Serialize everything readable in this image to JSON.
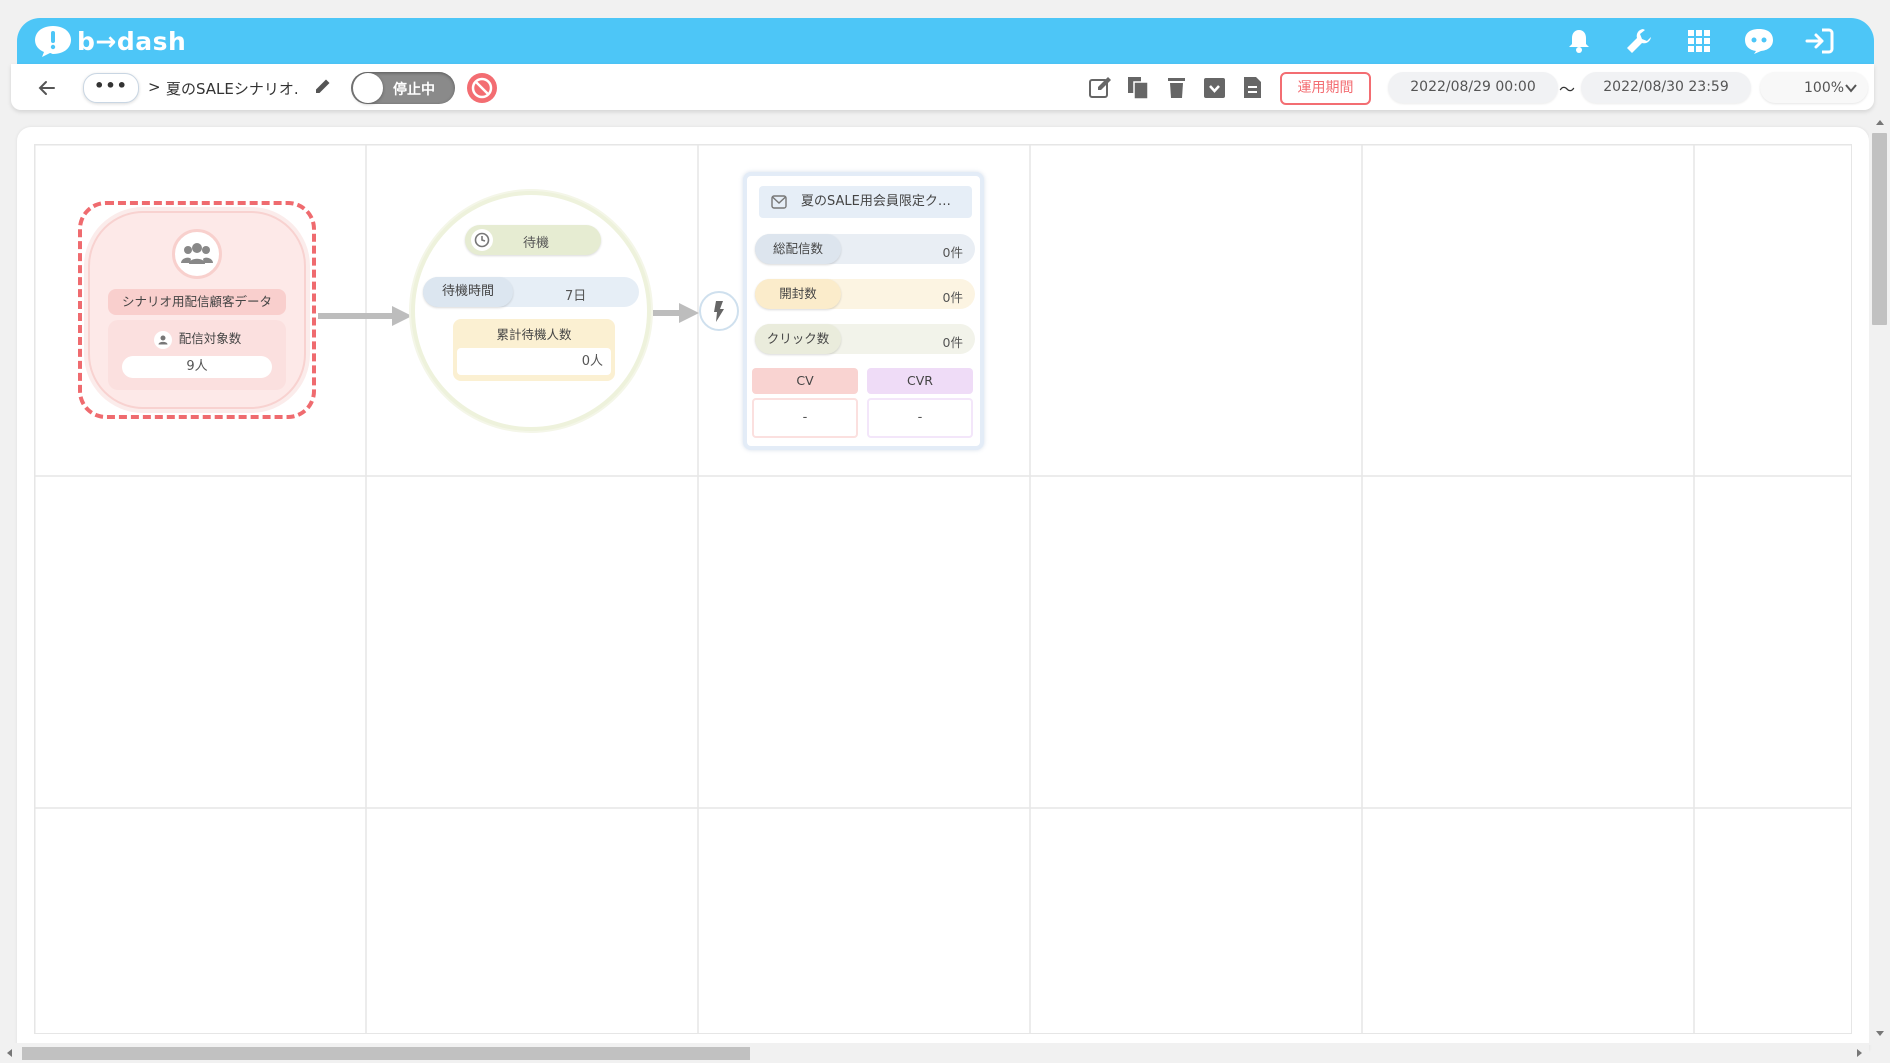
{
  "app": {
    "logo_text": "b→dash"
  },
  "header_icons": [
    "bell-icon",
    "wrench-icon",
    "apps-grid-icon",
    "chat-robot-icon",
    "logout-icon"
  ],
  "toolbar": {
    "more_label": "•••",
    "breadcrumb_sep": ">",
    "scenario_name": "夏のSALEシナリオ.",
    "toggle_label": "停止中",
    "period_label": "運用期間",
    "start_date": "2022/08/29 00:00",
    "tilde": "〜",
    "end_date": "2022/08/30 23:59",
    "zoom": "100%"
  },
  "segment_node": {
    "title": "シナリオ用配信顧客データ",
    "count_label": "配信対象数",
    "count_value": "9人"
  },
  "wait_node": {
    "label": "待機",
    "time_label": "待機時間",
    "time_value": "7日",
    "total_label": "累計待機人数",
    "total_value": "0人"
  },
  "mail_node": {
    "title": "夏のSALE用会員限定ク…",
    "stats": [
      {
        "label": "総配信数",
        "value": "0件"
      },
      {
        "label": "開封数",
        "value": "0件"
      },
      {
        "label": "クリック数",
        "value": "0件"
      }
    ],
    "cv_label": "CV",
    "cvr_label": "CVR",
    "cv_value": "-",
    "cvr_value": "-"
  },
  "colors": {
    "header": "#4dc6f7",
    "accent_red": "#ef6b6f",
    "segment_bg": "#fde9e8",
    "wait_green": "#e6ecd2",
    "mail_blue": "#e6eef7"
  }
}
